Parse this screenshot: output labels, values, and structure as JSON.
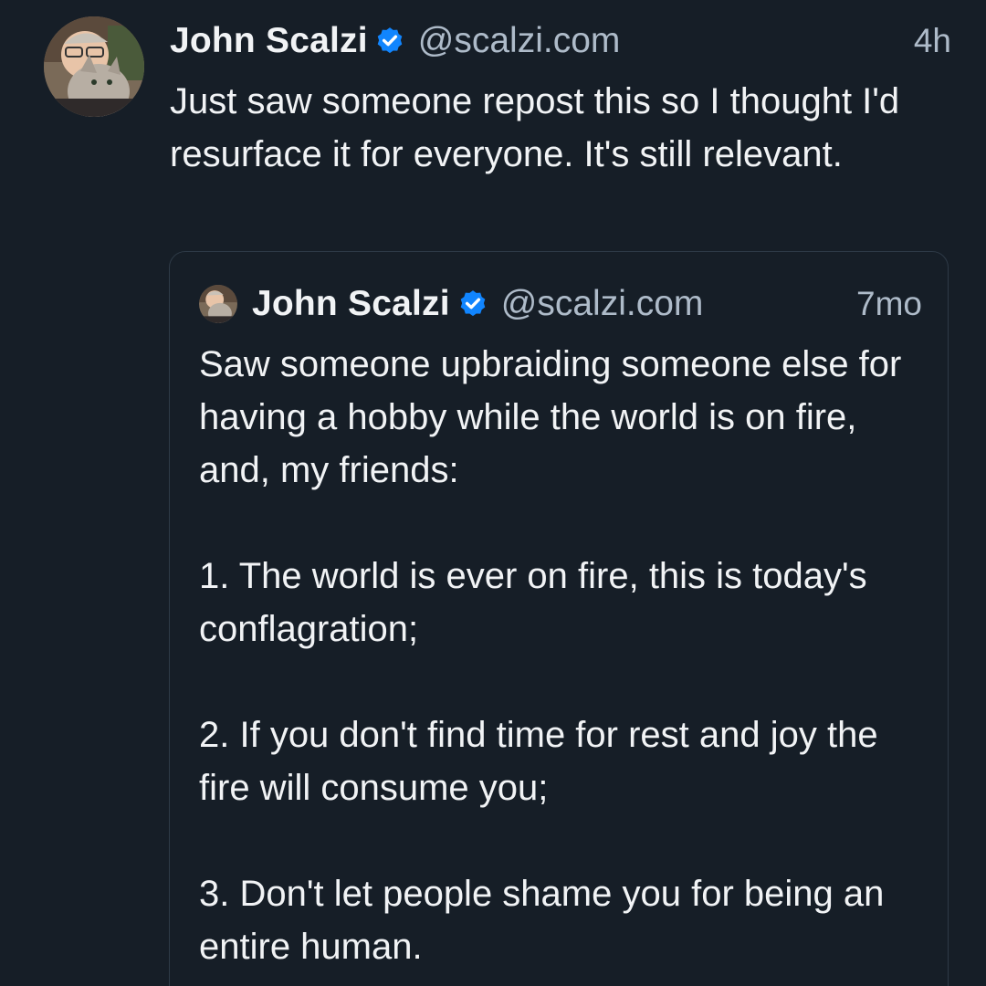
{
  "post": {
    "author_name": "John Scalzi",
    "handle": "@scalzi.com",
    "timestamp": "4h",
    "text": "Just saw someone repost this so I thought I'd resurface it for everyone. It's still relevant.",
    "verified_icon": "verified-badge-icon"
  },
  "quote": {
    "author_name": "John Scalzi",
    "handle": "@scalzi.com",
    "timestamp": "7mo",
    "paragraphs": [
      "Saw someone upbraiding someone else for having a hobby while the world is on fire, and, my friends:",
      "1. The world is ever on fire, this is today's conflagration;",
      "2. If you don't find time for rest and joy the fire will consume you;",
      "3. Don't let people shame you for being an entire human."
    ]
  },
  "colors": {
    "background": "#161e27",
    "text": "#f1f3f5",
    "muted": "#aebbc9",
    "verified": "#1185fe",
    "quote_border": "#2e3a47"
  }
}
